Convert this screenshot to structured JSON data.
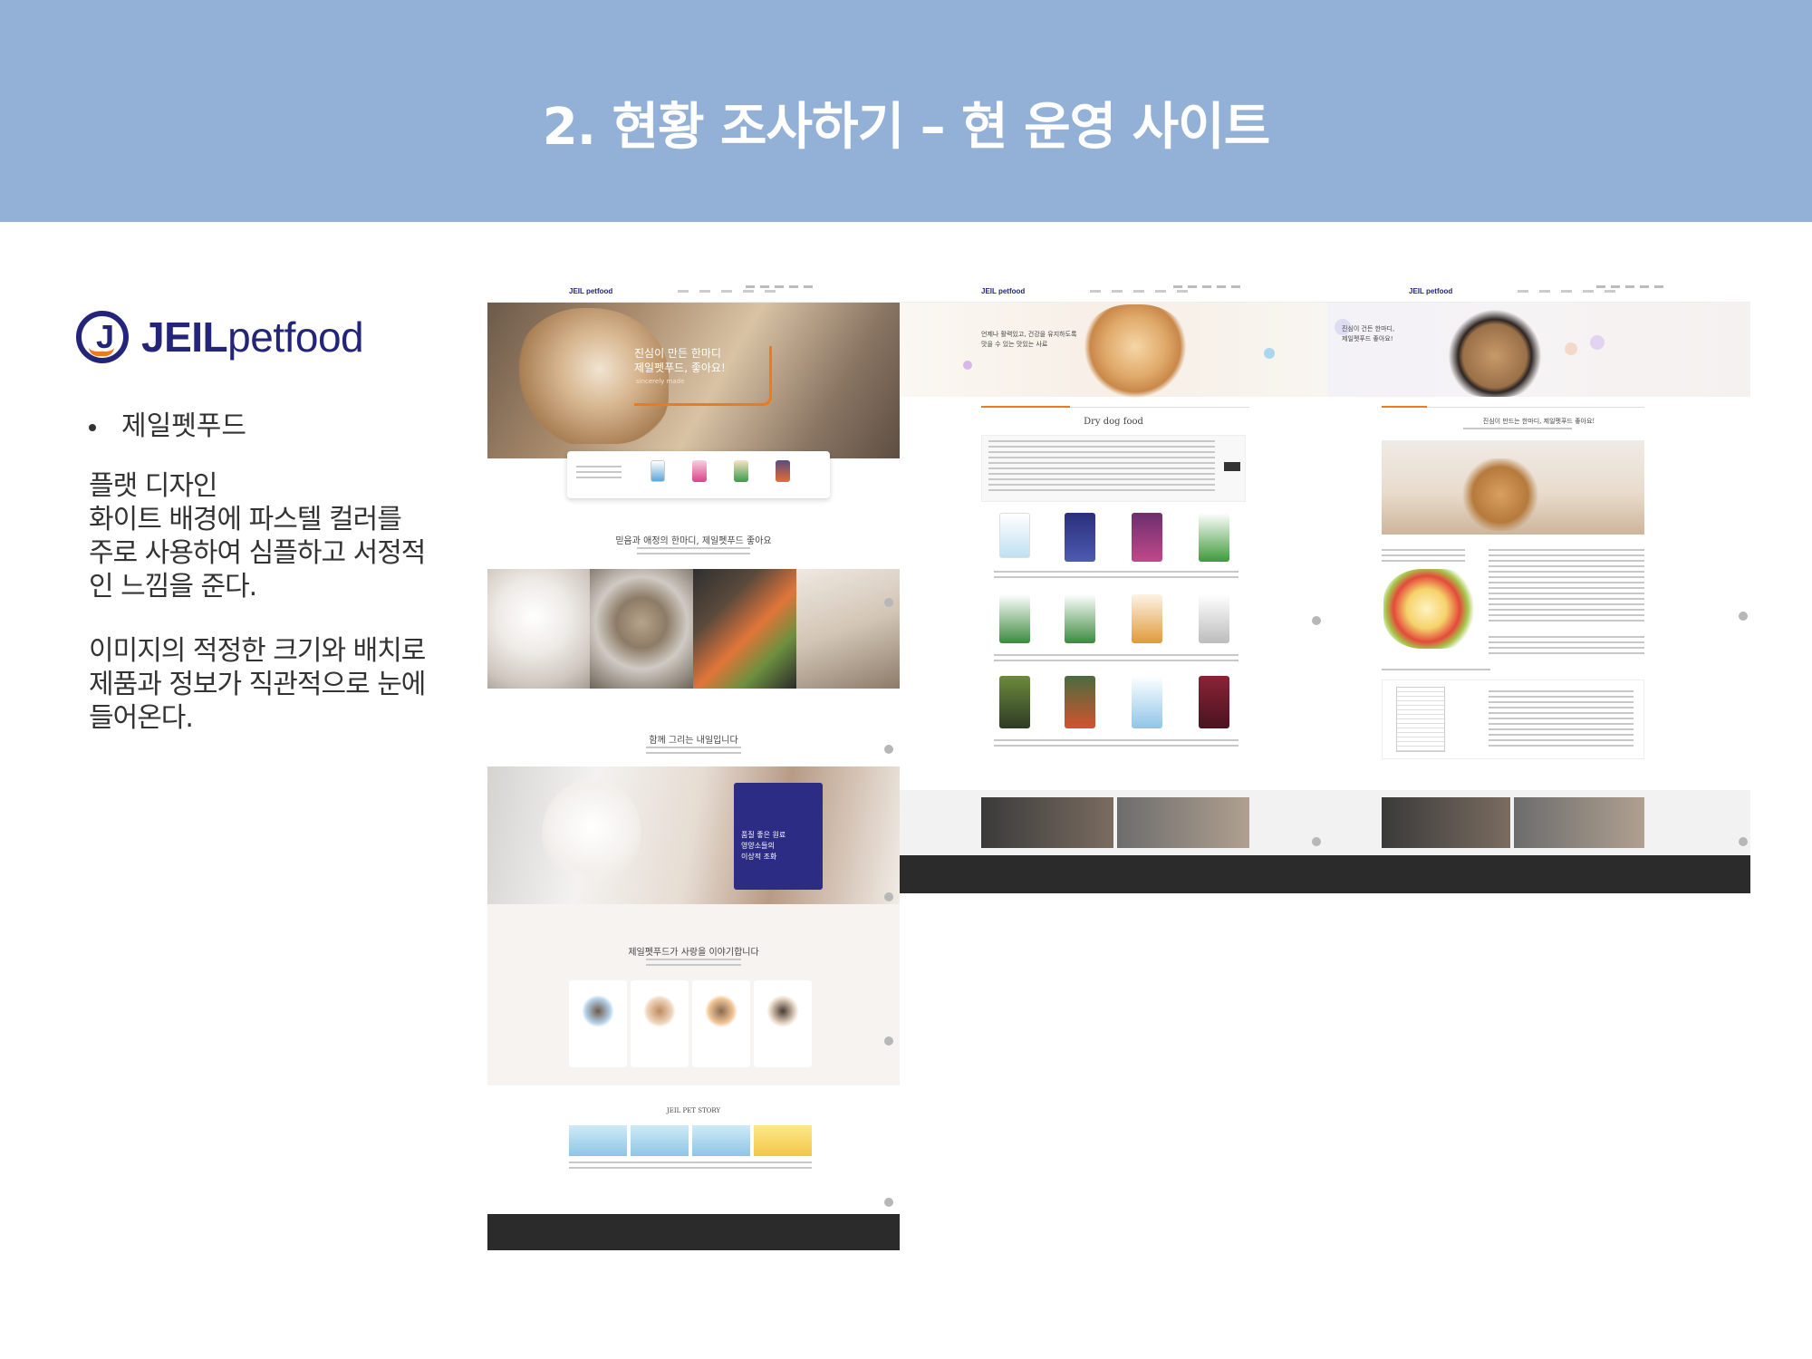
{
  "header": {
    "title": "2. 현황 조사하기 – 현 운영 사이트",
    "bg_color": "#93b0d6"
  },
  "brand": {
    "mark_letter": "J",
    "name_bold": "JEIL",
    "name_regular": "petfood",
    "color": "#23247a",
    "accent": "#f07a1b"
  },
  "left": {
    "bullet": "제일펫푸드",
    "desc1": "플랫 디자인\n화이트 배경에 파스텔 컬러를\n주로 사용하여 심플하고 서정적\n인 느낌을 준다.",
    "desc2": "이미지의 적정한 크기와 배치로\n제품과 정보가 직관적으로 눈에\n들어온다."
  },
  "shot_main": {
    "hero_text": "진심이 만든 한마디\n제일펫푸드, 좋아요!",
    "hero_sub": "sincerely made",
    "section1_title": "믿음과 애정의 한마디, 제일펫푸드 좋아요",
    "section2_title": "함께 그리는 내일입니다",
    "promo_text": "품질 좋은 원료\n영양소들의\n이상적 조화",
    "section3_title": "제일펫푸드가 사랑을 이야기합니다",
    "story_title": "JEIL PET STORY"
  },
  "shot_list": {
    "banner_text": "언제나 활력있고, 건강을 유지하도록\n맛을 수 있는 맛있는 사료",
    "list_title": "Dry dog food"
  },
  "shot_story": {
    "banner_text": "진심이 건든 한마디,\n제일펫푸드 좋아요!",
    "title": "진심이 만드는 한마디, 제일펫푸드 좋아요!"
  }
}
